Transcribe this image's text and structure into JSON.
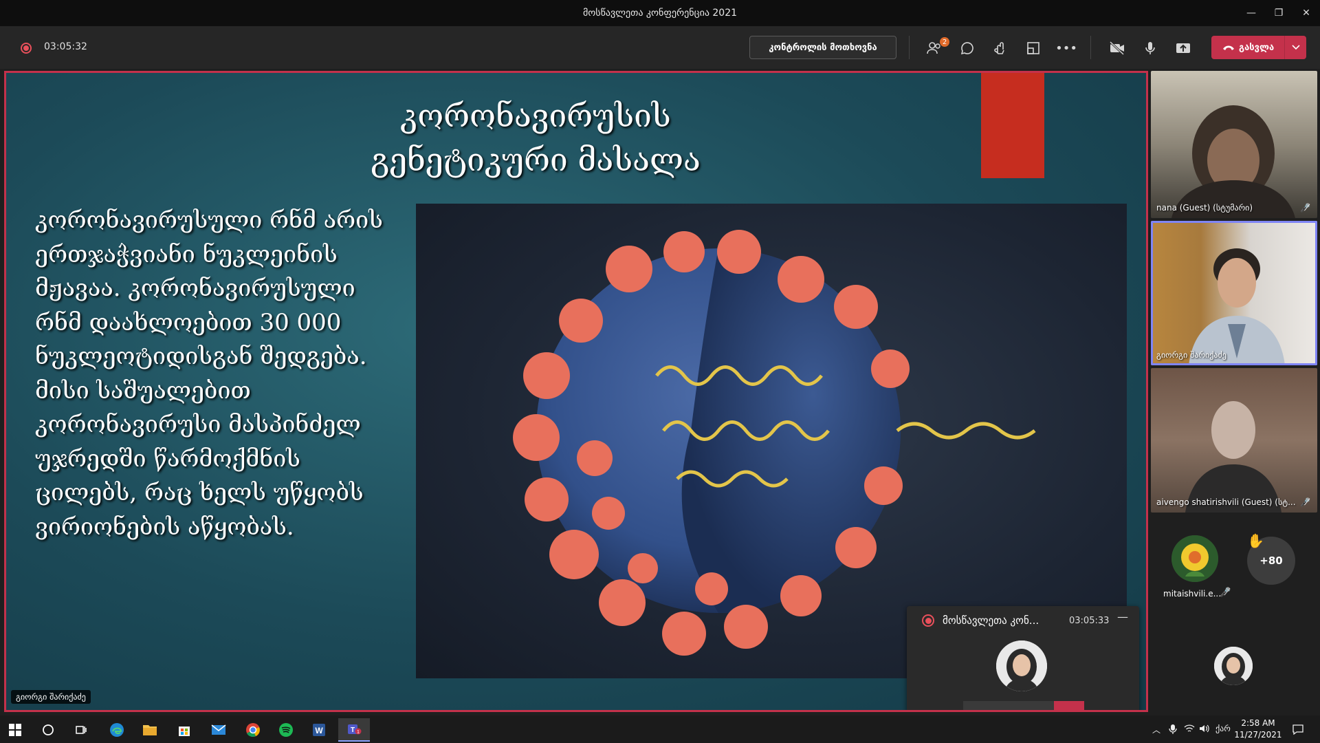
{
  "window": {
    "title": "მოსწავლეთა კონფერენცია 2021",
    "controls": [
      "minimize-icon",
      "restore-icon",
      "close-icon"
    ]
  },
  "toolbar": {
    "recording_time": "03:05:32",
    "control_button": "კონტროლის მოთხოვნა",
    "participants_badge": "2",
    "leave_label": "გასვლა",
    "icons": [
      "participants-icon",
      "chat-icon",
      "reactions-icon",
      "rooms-icon",
      "more-options-icon",
      "camera-off-icon",
      "microphone-icon",
      "share-screen-icon"
    ]
  },
  "slide": {
    "title_line1": "კორონავირუსის",
    "title_line2": "გენეტიკური მასალა",
    "body": " კორონავირუსული რნმ არის ერთჯაჭვიანი ნუკლეინის მჟავაა. კორონავირუსული რნმ დაახლოებით 30 000 ნუკლეოტიდისგან შედგება. მისი საშუალებით კორონავირუსი მასპინძელ უჯრედში წარმოქმნის ცილებს, რაც ხელს უწყობს ვირიონების აწყობას.",
    "presenter_tag": "გიორგი შარიქაძე"
  },
  "mini_window": {
    "title": "მოსწავლეთა კონ...",
    "time": "03:05:33"
  },
  "participants": [
    {
      "name": "nana (Guest) (სტუმარი)",
      "muted": true
    },
    {
      "name": "გიორგი შარიქაძე",
      "muted": false,
      "active": true
    },
    {
      "name": "aivengo shatirishvili (Guest) (სტ...",
      "muted": true
    }
  ],
  "small_participant": {
    "name": "mitaishvili.e...",
    "muted": true
  },
  "overflow_count": "+80",
  "taskbar": {
    "apps": [
      "windows-start-icon",
      "search-icon",
      "task-view-icon",
      "edge-icon",
      "file-explorer-icon",
      "store-icon",
      "mail-icon",
      "chrome-icon",
      "spotify-icon",
      "word-icon",
      "teams-icon"
    ],
    "language": "ქარ",
    "time": "2:58 AM",
    "date": "11/27/2021"
  },
  "colors": {
    "accent_red": "#c4314b",
    "active_outline": "#7f85f5",
    "slide_bg": "#1c4a58"
  }
}
